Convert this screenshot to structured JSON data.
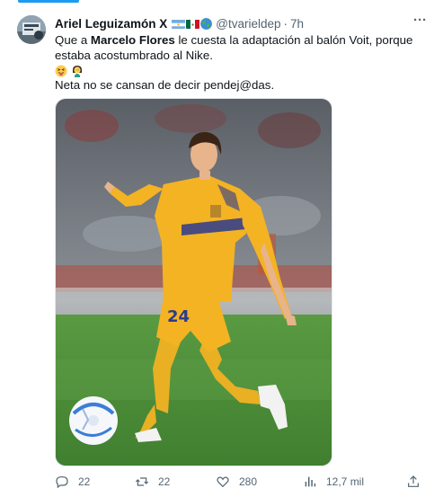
{
  "tweet": {
    "author_name": "Ariel Leguizamón X",
    "handle": "@tvarieldep",
    "separator": "·",
    "time": "7h",
    "text_line1_pre": "Que a ",
    "text_line1_bold": "Marcelo Flores",
    "text_line1_post": " le cuesta la adaptación al balón Voit, porque estaba acostumbrado al Nike.",
    "text_line3": "Neta no se cansan de decir pendej@das.",
    "emojis": [
      "squinting-tongue-emoji",
      "woman-facepalming-emoji"
    ],
    "flag_icons": [
      "argentina-flag-icon",
      "mexico-flag-icon",
      "globe-icon"
    ]
  },
  "media": {
    "jersey_number": "24"
  },
  "actions": {
    "replies": "22",
    "retweets": "22",
    "likes": "280",
    "views": "12,7 mil"
  },
  "colors": {
    "accent": "#1d9bf0",
    "secondary_text": "#536471",
    "primary_text": "#0f1419",
    "jersey_yellow": "#f4b323",
    "pitch_green": "#4f8f3a"
  }
}
